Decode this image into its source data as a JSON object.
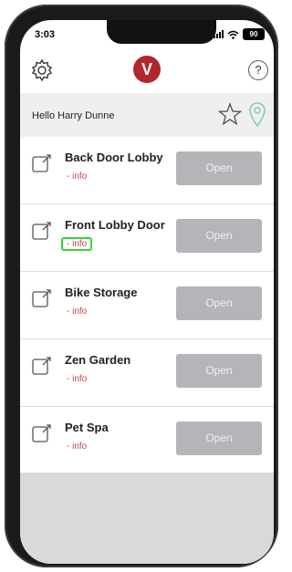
{
  "status": {
    "time": "3:03",
    "battery": "90"
  },
  "header": {
    "logo_letter": "V",
    "help_label": "?"
  },
  "greeting": "Hello Harry Dunne",
  "doors": [
    {
      "name": "Back Door Lobby",
      "info": "- info",
      "button": "Open"
    },
    {
      "name": "Front Lobby Door",
      "info": "- info",
      "button": "Open"
    },
    {
      "name": "Bike Storage",
      "info": "- info",
      "button": "Open"
    },
    {
      "name": "Zen Garden",
      "info": "- info",
      "button": "Open"
    },
    {
      "name": "Pet Spa",
      "info": "- info",
      "button": "Open"
    }
  ],
  "colors": {
    "brand": "#b2262e",
    "info_text": "#c04848",
    "highlight": "#38d038",
    "pin": "#7fd0a6"
  }
}
